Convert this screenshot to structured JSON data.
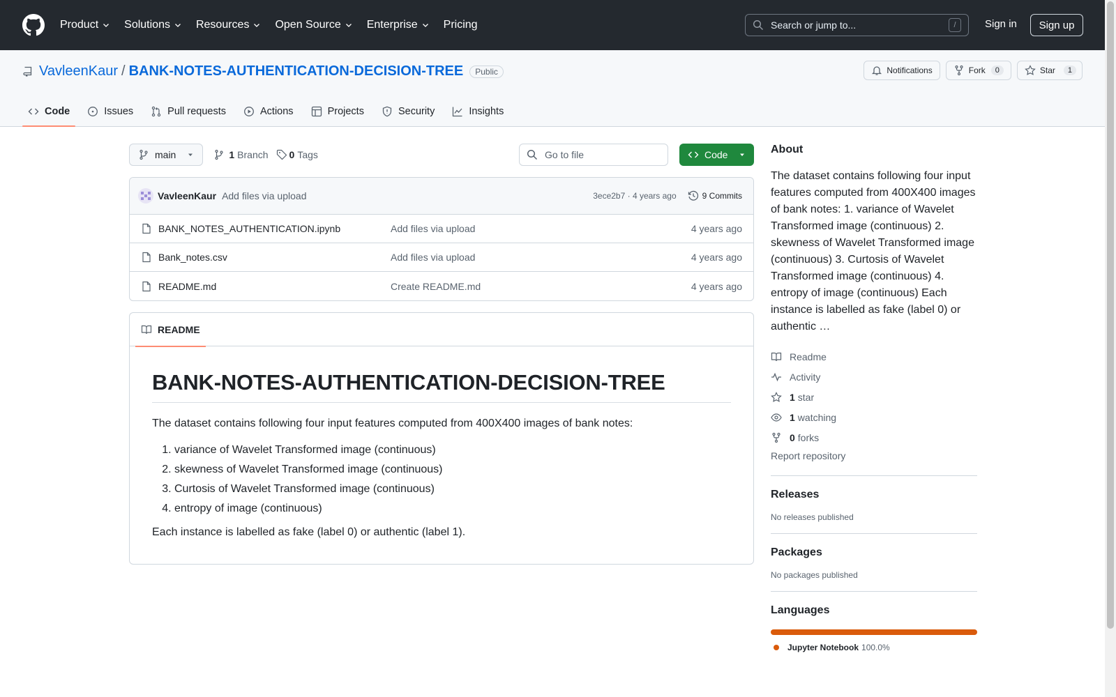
{
  "header": {
    "nav": [
      {
        "label": "Product",
        "dropdown": true
      },
      {
        "label": "Solutions",
        "dropdown": true
      },
      {
        "label": "Resources",
        "dropdown": true
      },
      {
        "label": "Open Source",
        "dropdown": true
      },
      {
        "label": "Enterprise",
        "dropdown": true
      },
      {
        "label": "Pricing",
        "dropdown": false
      }
    ],
    "search_placeholder": "Search or jump to...",
    "search_shortcut": "/",
    "sign_in": "Sign in",
    "sign_up": "Sign up"
  },
  "repo": {
    "owner": "VavleenKaur",
    "separator": "/",
    "name": "BANK-NOTES-AUTHENTICATION-DECISION-TREE",
    "visibility": "Public",
    "notifications_label": "Notifications",
    "fork_label": "Fork",
    "fork_count": "0",
    "star_label": "Star",
    "star_count": "1"
  },
  "tabs": [
    {
      "label": "Code",
      "icon": "code-icon",
      "active": true
    },
    {
      "label": "Issues",
      "icon": "issue-icon",
      "active": false
    },
    {
      "label": "Pull requests",
      "icon": "pull-request-icon",
      "active": false
    },
    {
      "label": "Actions",
      "icon": "play-icon",
      "active": false
    },
    {
      "label": "Projects",
      "icon": "table-icon",
      "active": false
    },
    {
      "label": "Security",
      "icon": "shield-icon",
      "active": false
    },
    {
      "label": "Insights",
      "icon": "graph-icon",
      "active": false
    }
  ],
  "toolbar": {
    "branch": "main",
    "branch_count": "1",
    "branch_label": "Branch",
    "tag_count": "0",
    "tag_label": "Tags",
    "goto_placeholder": "Go to file",
    "code_button": "Code"
  },
  "commit": {
    "author": "VavleenKaur",
    "message": "Add files via upload",
    "hash_age": "3ece2b7 · 4 years ago",
    "commits": "9 Commits"
  },
  "files": [
    {
      "name": "BANK_NOTES_AUTHENTICATION.ipynb",
      "message": "Add files via upload",
      "age": "4 years ago"
    },
    {
      "name": "Bank_notes.csv",
      "message": "Add files via upload",
      "age": "4 years ago"
    },
    {
      "name": "README.md",
      "message": "Create README.md",
      "age": "4 years ago"
    }
  ],
  "readme": {
    "tab": "README",
    "title": "BANK-NOTES-AUTHENTICATION-DECISION-TREE",
    "intro": "The dataset contains following four input features computed from 400X400 images of bank notes:",
    "items": [
      "variance of Wavelet Transformed image (continuous)",
      "skewness of Wavelet Transformed image (continuous)",
      "Curtosis of Wavelet Transformed image (continuous)",
      "entropy of image (continuous)"
    ],
    "outro": "Each instance is labelled as fake (label 0) or authentic (label 1)."
  },
  "about": {
    "heading": "About",
    "description": "The dataset contains following four input features computed from 400X400 images of bank notes: 1. variance of Wavelet Transformed image (continuous) 2. skewness of Wavelet Transformed image (continuous) 3. Curtosis of Wavelet Transformed image (continuous) 4. entropy of image (continuous) Each instance is labelled as fake (label 0) or authentic …",
    "readme": "Readme",
    "activity": "Activity",
    "stars_count": "1",
    "stars_label": "star",
    "watching_count": "1",
    "watching_label": "watching",
    "forks_count": "0",
    "forks_label": "forks",
    "report": "Report repository"
  },
  "releases": {
    "heading": "Releases",
    "text": "No releases published"
  },
  "packages": {
    "heading": "Packages",
    "text": "No packages published"
  },
  "languages": {
    "heading": "Languages",
    "items": [
      {
        "name": "Jupyter Notebook",
        "percent": "100.0%",
        "color": "#da5b0b"
      }
    ]
  }
}
